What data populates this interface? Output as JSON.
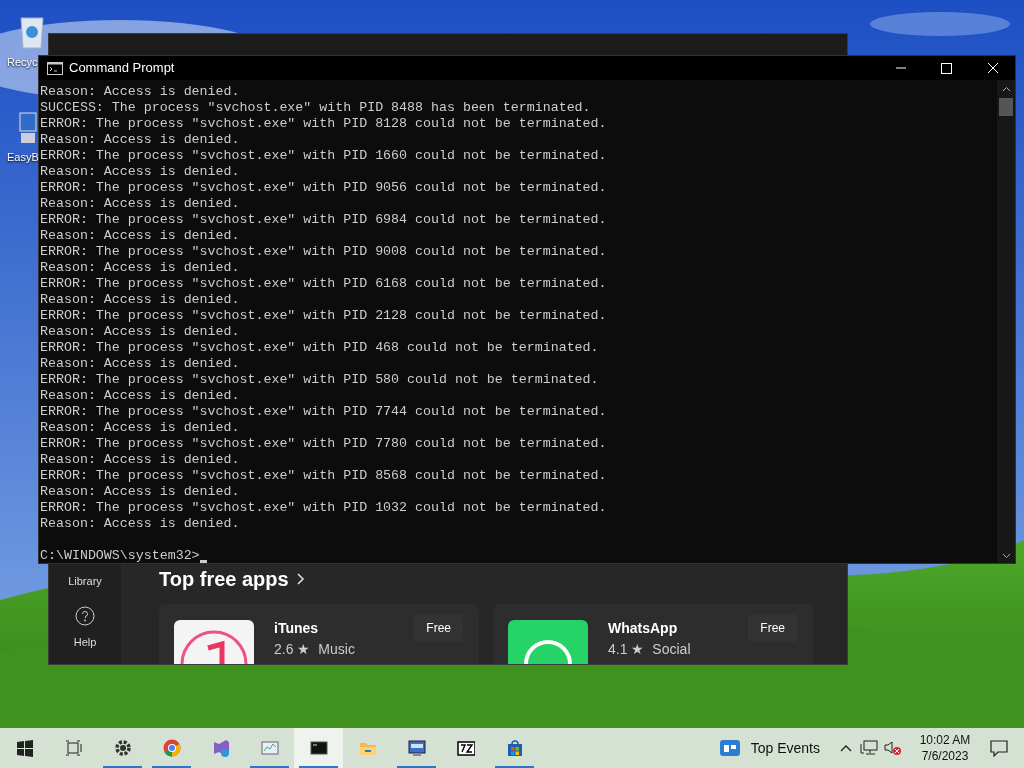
{
  "desktop_icons": [
    {
      "label": "Recyc",
      "kind": "recycle"
    },
    {
      "label": "EasyB",
      "kind": "computer"
    }
  ],
  "store_window": {
    "sidebar": [
      {
        "label": "Library",
        "kind": "library"
      },
      {
        "label": "Help",
        "kind": "help"
      }
    ],
    "section_title": "Top free apps",
    "apps": [
      {
        "name": "iTunes",
        "rating": "2.6 ★",
        "category": "Music",
        "price": "Free",
        "kind": "music"
      },
      {
        "name": "WhatsApp",
        "rating": "4.1 ★",
        "category": "Social",
        "price": "Free",
        "kind": "chat"
      }
    ]
  },
  "cmd": {
    "title": "Command Prompt",
    "lines": [
      "Reason: Access is denied.",
      "SUCCESS: The process \"svchost.exe\" with PID 8488 has been terminated.",
      "ERROR: The process \"svchost.exe\" with PID 8128 could not be terminated.",
      "Reason: Access is denied.",
      "ERROR: The process \"svchost.exe\" with PID 1660 could not be terminated.",
      "Reason: Access is denied.",
      "ERROR: The process \"svchost.exe\" with PID 9056 could not be terminated.",
      "Reason: Access is denied.",
      "ERROR: The process \"svchost.exe\" with PID 6984 could not be terminated.",
      "Reason: Access is denied.",
      "ERROR: The process \"svchost.exe\" with PID 9008 could not be terminated.",
      "Reason: Access is denied.",
      "ERROR: The process \"svchost.exe\" with PID 6168 could not be terminated.",
      "Reason: Access is denied.",
      "ERROR: The process \"svchost.exe\" with PID 2128 could not be terminated.",
      "Reason: Access is denied.",
      "ERROR: The process \"svchost.exe\" with PID 468 could not be terminated.",
      "Reason: Access is denied.",
      "ERROR: The process \"svchost.exe\" with PID 580 could not be terminated.",
      "Reason: Access is denied.",
      "ERROR: The process \"svchost.exe\" with PID 7744 could not be terminated.",
      "Reason: Access is denied.",
      "ERROR: The process \"svchost.exe\" with PID 7780 could not be terminated.",
      "Reason: Access is denied.",
      "ERROR: The process \"svchost.exe\" with PID 8568 could not be terminated.",
      "Reason: Access is denied.",
      "ERROR: The process \"svchost.exe\" with PID 1032 could not be terminated.",
      "Reason: Access is denied."
    ],
    "prompt": "C:\\WINDOWS\\system32>"
  },
  "taskbar": {
    "apps": [
      {
        "kind": "start",
        "running": false,
        "active": false
      },
      {
        "kind": "taskview",
        "running": false,
        "active": false
      },
      {
        "kind": "settings",
        "running": true,
        "active": false
      },
      {
        "kind": "browser",
        "running": true,
        "active": false
      },
      {
        "kind": "studio",
        "running": false,
        "active": false
      },
      {
        "kind": "monitor",
        "running": true,
        "active": false
      },
      {
        "kind": "terminal",
        "running": true,
        "active": true
      },
      {
        "kind": "folder",
        "running": false,
        "active": false
      },
      {
        "kind": "network",
        "running": true,
        "active": false
      },
      {
        "kind": "archiver",
        "running": false,
        "active": false
      },
      {
        "kind": "store",
        "running": true,
        "active": false
      }
    ],
    "widget": "Top Events",
    "time": "10:02 AM",
    "date": "7/6/2023"
  }
}
